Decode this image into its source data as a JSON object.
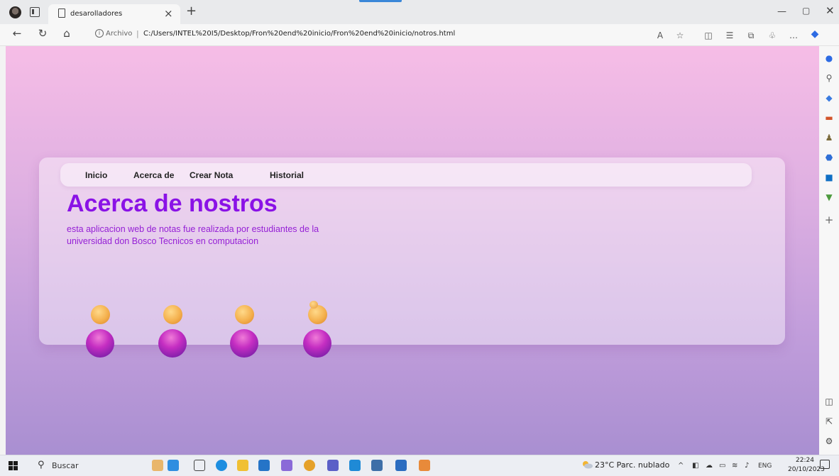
{
  "browser": {
    "tab_title": "desarolladores",
    "tab_close": "×",
    "new_tab": "+",
    "address_prefix": "Archivo",
    "address_separator": "|",
    "url": "C:/Users/INTEL%20I5/Desktop/Fron%20end%20inicio/Fron%20end%20inicio/notros.html",
    "window_min": "—",
    "window_max": "▢",
    "window_close": "✕"
  },
  "page": {
    "nav": [
      "Inicio",
      "Acerca de",
      "Crear Nota",
      "Historial"
    ],
    "heading": "Acerca de nostros",
    "description": "esta aplicacion web de notas fue realizada por estudiantes de la universidad don Bosco Tecnicos en computacion",
    "colors": {
      "heading": "#8a12e6",
      "background_top": "#f6bde6",
      "background_bottom": "#a98fd1"
    }
  },
  "taskbar": {
    "search_label": "Buscar",
    "weather": "23°C  Parc. nublado",
    "language": "ENG",
    "time": "22:24",
    "date": "20/10/2023"
  },
  "icons": {
    "sidebar": [
      "notification-icon",
      "search-icon",
      "tag-icon",
      "toolbox-icon",
      "chess-icon",
      "office-icon",
      "outlook-icon",
      "designer-icon",
      "add-icon"
    ],
    "sidebar_bottom": [
      "split-screen-icon",
      "external-link-icon",
      "settings-icon"
    ]
  }
}
